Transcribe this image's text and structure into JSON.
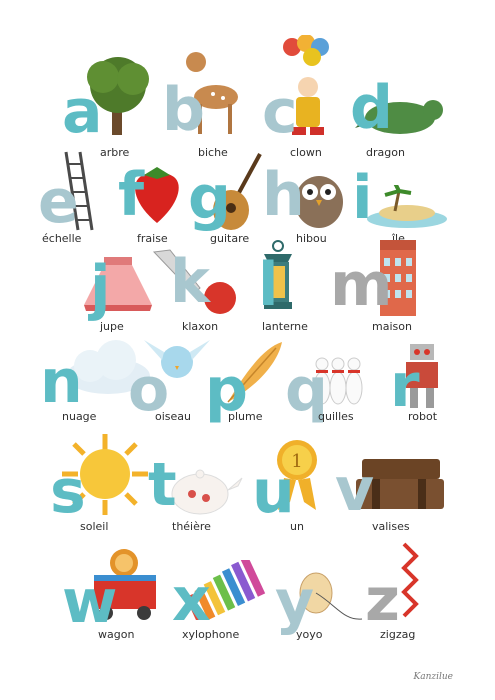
{
  "letters": [
    {
      "char": "a",
      "word": "arbre",
      "color": "#5dbcc4"
    },
    {
      "char": "b",
      "word": "biche",
      "color": "#a8c7cf"
    },
    {
      "char": "c",
      "word": "clown",
      "color": "#a8c7cf"
    },
    {
      "char": "d",
      "word": "dragon",
      "color": "#5dbcc4"
    },
    {
      "char": "e",
      "word": "échelle",
      "color": "#a8c7cf"
    },
    {
      "char": "f",
      "word": "fraise",
      "color": "#5dbcc4"
    },
    {
      "char": "g",
      "word": "guitare",
      "color": "#5dbcc4"
    },
    {
      "char": "h",
      "word": "hibou",
      "color": "#a8c7cf"
    },
    {
      "char": "i",
      "word": "île",
      "color": "#5dbcc4"
    },
    {
      "char": "j",
      "word": "jupe",
      "color": "#5dbcc4"
    },
    {
      "char": "k",
      "word": "klaxon",
      "color": "#a8c7cf"
    },
    {
      "char": "l",
      "word": "lanterne",
      "color": "#5dbcc4"
    },
    {
      "char": "m",
      "word": "maison",
      "color": "#a8a8a8"
    },
    {
      "char": "n",
      "word": "nuage",
      "color": "#5dbcc4"
    },
    {
      "char": "o",
      "word": "oiseau",
      "color": "#a8c7cf"
    },
    {
      "char": "p",
      "word": "plume",
      "color": "#5dbcc4"
    },
    {
      "char": "q",
      "word": "quilles",
      "color": "#a8c7cf"
    },
    {
      "char": "r",
      "word": "robot",
      "color": "#5dbcc4"
    },
    {
      "char": "s",
      "word": "soleil",
      "color": "#5dbcc4"
    },
    {
      "char": "t",
      "word": "théière",
      "color": "#5dbcc4"
    },
    {
      "char": "u",
      "word": "un",
      "color": "#5dbcc4"
    },
    {
      "char": "v",
      "word": "valises",
      "color": "#a8c7cf"
    },
    {
      "char": "w",
      "word": "wagon",
      "color": "#5dbcc4"
    },
    {
      "char": "x",
      "word": "xylophone",
      "color": "#5dbcc4"
    },
    {
      "char": "y",
      "word": "yoyo",
      "color": "#a8c7cf"
    },
    {
      "char": "z",
      "word": "zigzag",
      "color": "#a8a8a8"
    }
  ],
  "signature": "Kanzilue"
}
